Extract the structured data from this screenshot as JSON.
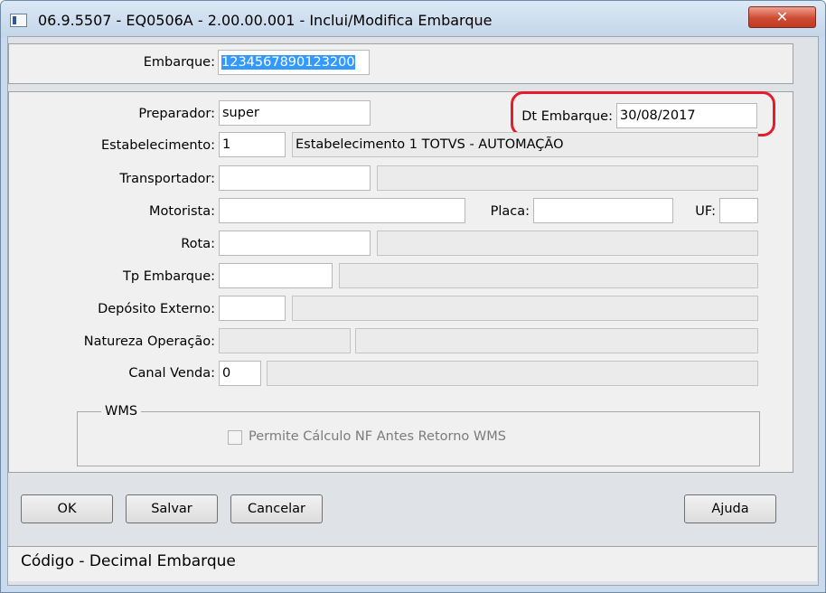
{
  "window": {
    "title": "06.9.5507 - EQ0506A - 2.00.00.001 - Inclui/Modifica Embarque",
    "close_glyph": "✕"
  },
  "embarque": {
    "label": "Embarque:",
    "value": "1234567890123200"
  },
  "preparador": {
    "label": "Preparador:",
    "value": "super"
  },
  "dt_embarque": {
    "label": "Dt Embarque:",
    "value": "30/08/2017"
  },
  "estabelecimento": {
    "label": "Estabelecimento:",
    "value": "1",
    "description": "Estabelecimento 1 TOTVS - AUTOMAÇÃO"
  },
  "transportador": {
    "label": "Transportador:",
    "value": "",
    "description": ""
  },
  "motorista": {
    "label": "Motorista:",
    "value": ""
  },
  "placa": {
    "label": "Placa:",
    "value": ""
  },
  "uf": {
    "label": "UF:",
    "value": ""
  },
  "rota": {
    "label": "Rota:",
    "value": "",
    "description": ""
  },
  "tp_embarque": {
    "label": "Tp Embarque:",
    "value": "",
    "description": ""
  },
  "deposito_externo": {
    "label": "Depósito Externo:",
    "value": "",
    "description": ""
  },
  "natureza_operacao": {
    "label": "Natureza Operação:",
    "value": "",
    "description": ""
  },
  "canal_venda": {
    "label": "Canal Venda:",
    "value": "0",
    "description": ""
  },
  "wms": {
    "title": "WMS",
    "checkbox_label": "Permite Cálculo NF Antes Retorno WMS",
    "checked": false
  },
  "buttons": {
    "ok": "OK",
    "salvar": "Salvar",
    "cancelar": "Cancelar",
    "ajuda": "Ajuda"
  },
  "status": {
    "text": "Código - Decimal Embarque"
  },
  "colors": {
    "highlight": "#e41d2c",
    "selection": "#3399ff"
  }
}
